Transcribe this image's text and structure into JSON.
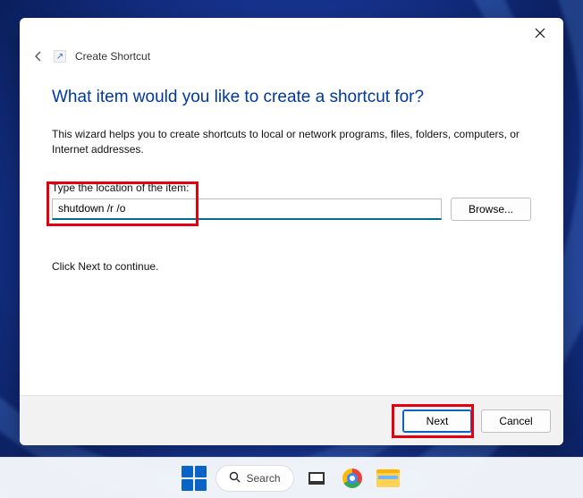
{
  "window": {
    "breadcrumb": "Create Shortcut",
    "close_tooltip": "Close"
  },
  "wizard": {
    "heading": "What item would you like to create a shortcut for?",
    "description": "This wizard helps you to create shortcuts to local or network programs, files, folders, computers, or Internet addresses.",
    "location_label": "Type the location of the item:",
    "location_value": "shutdown /r /o",
    "browse_label": "Browse...",
    "continue_hint": "Click Next to continue."
  },
  "footer": {
    "next_label": "Next",
    "cancel_label": "Cancel"
  },
  "taskbar": {
    "search_label": "Search"
  }
}
